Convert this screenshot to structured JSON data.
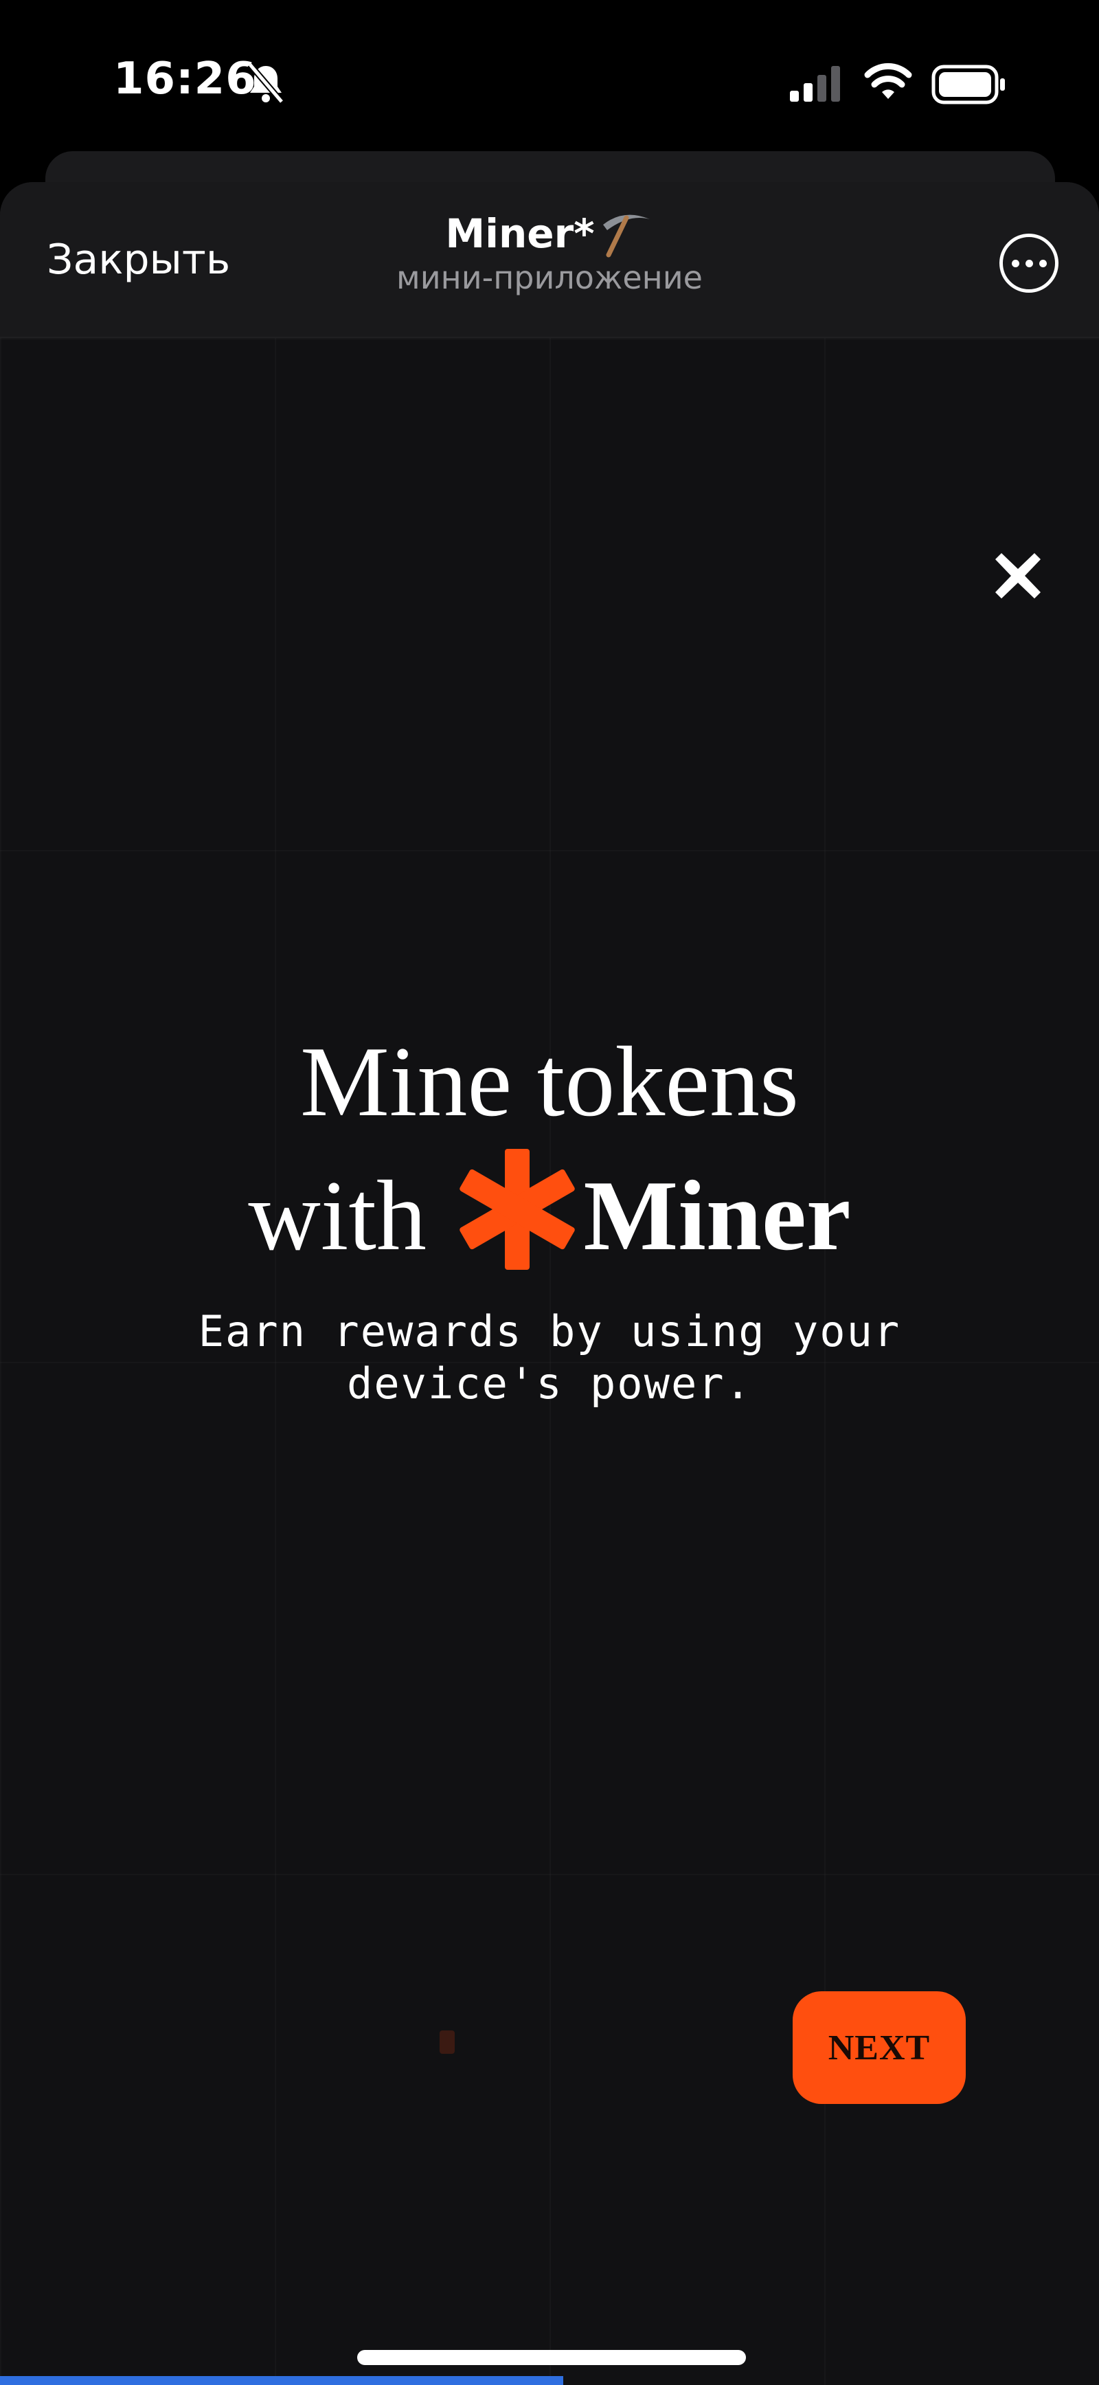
{
  "status_bar": {
    "time": "16:26",
    "icons": [
      "bell-slash-icon",
      "cellular-signal-icon",
      "wifi-icon",
      "battery-icon"
    ]
  },
  "header": {
    "close_label": "Закрыть",
    "title": "Miner*",
    "title_icon": "pickaxe-icon",
    "subtitle": "мини-приложение",
    "more_icon": "more-icon"
  },
  "onboarding": {
    "close_icon": "close-x-icon",
    "headline_line1": "Mine tokens",
    "headline_prefix": "with",
    "brand_icon": "asterisk-logo-icon",
    "brand_name": "Miner",
    "subtitle": "Earn rewards by using your device's power.",
    "next_label": "NEXT",
    "pager_icon": "page-indicator-dot"
  },
  "colors": {
    "accent": "#ff4f0f",
    "background": "#111113",
    "header_bg": "#19191b"
  }
}
